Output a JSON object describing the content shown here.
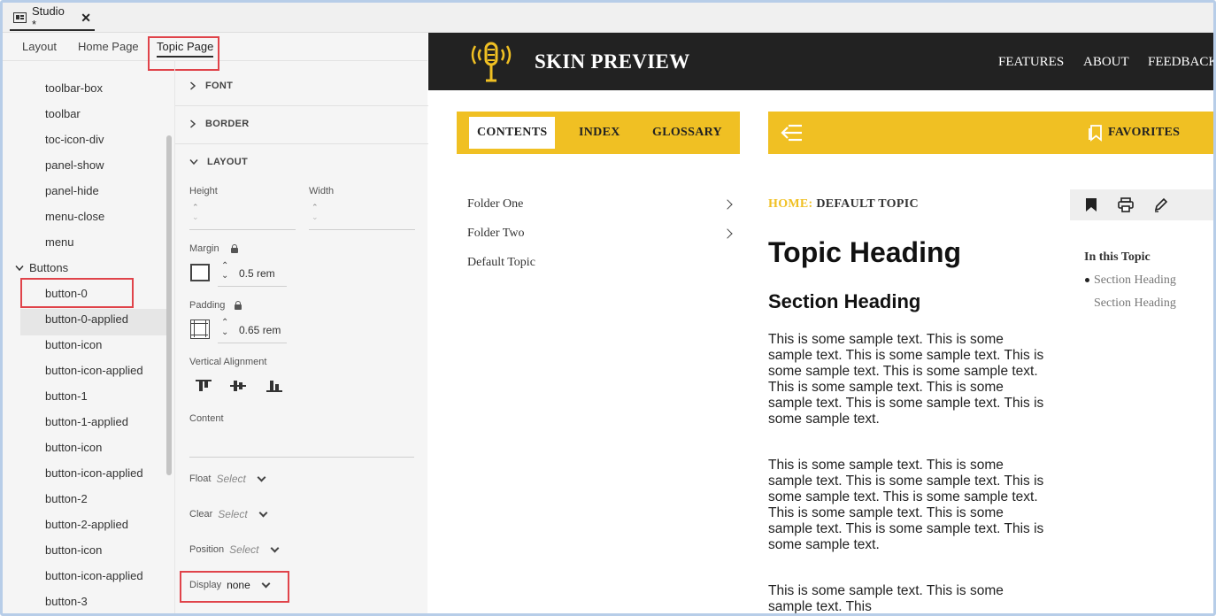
{
  "window": {
    "tab_title": "Studio *",
    "close_glyph": "✕"
  },
  "subtabs": [
    "Layout",
    "Home Page",
    "Topic Page"
  ],
  "tree": {
    "items_top": [
      "toolbar-box",
      "toolbar",
      "toc-icon-div",
      "panel-show",
      "panel-hide",
      "menu-close",
      "menu"
    ],
    "group_label": "Buttons",
    "group_items": [
      "button-0",
      "button-0-applied",
      "button-icon",
      "button-icon-applied",
      "button-1",
      "button-1-applied",
      "button-icon",
      "button-icon-applied",
      "button-2",
      "button-2-applied",
      "button-icon",
      "button-icon-applied",
      "button-3"
    ]
  },
  "props": {
    "font_label": "FONT",
    "border_label": "BORDER",
    "layout_label": "LAYOUT",
    "height_label": "Height",
    "width_label": "Width",
    "margin_label": "Margin",
    "margin_value": "0.5 rem",
    "padding_label": "Padding",
    "padding_value": "0.65 rem",
    "valign_label": "Vertical Alignment",
    "content_label": "Content",
    "float_label": "Float",
    "clear_label": "Clear",
    "position_label": "Position",
    "select_placeholder": "Select",
    "display_label": "Display",
    "display_value": "none"
  },
  "preview": {
    "brand": "SKIN PREVIEW",
    "nav": [
      "FEATURES",
      "ABOUT",
      "FEEDBACK"
    ],
    "toc_tabs": [
      "CONTENTS",
      "INDEX",
      "GLOSSARY"
    ],
    "favorites": "FAVORITES",
    "folders": [
      "Folder One",
      "Folder Two",
      "Default Topic"
    ],
    "breadcrumb_home": "HOME:",
    "breadcrumb_topic": "DEFAULT TOPIC",
    "topic_heading": "Topic Heading",
    "section_heading": "Section Heading",
    "paragraphs": [
      "This is some sample text. This is some sample text. This is some sample text. This is some sample text. This is some sample text. This is some sample text. This is some sample text. This is some sample text. This is some sample text.",
      "This is some sample text. This is some sample text. This is some sample text. This is some sample text. This is some sample text. This is some sample text. This is some sample text. This is some sample text. This is some sample text.",
      "This is some sample text. This is some sample text. This"
    ],
    "mini_toc_title": "In this Topic",
    "mini_toc_items": [
      "Section Heading",
      "Section Heading"
    ]
  },
  "colors": {
    "accent_yellow": "#f0c023",
    "header_dark": "#222222",
    "highlight_red": "#e0434a"
  }
}
